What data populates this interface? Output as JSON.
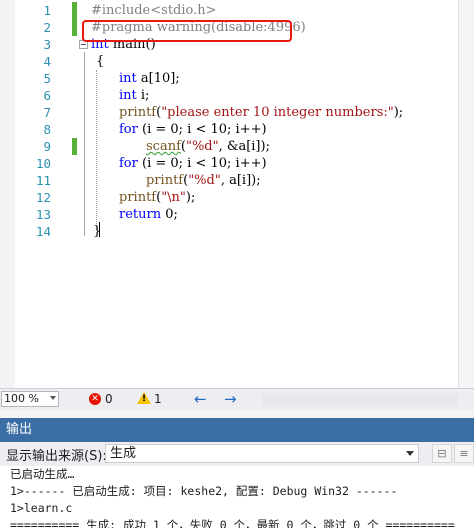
{
  "editor": {
    "line_numbers": [
      "1",
      "2",
      "3",
      "4",
      "5",
      "6",
      "7",
      "8",
      "9",
      "10",
      "11",
      "12",
      "13",
      "14"
    ],
    "code": {
      "l1": "#include<stdio.h>",
      "l2": "#pragma warning(disable:4996)",
      "l3_kw": "int",
      "l3_rest": " main()",
      "l4": "{",
      "l5_kw": "int",
      "l5_rest": " a[10];",
      "l6_kw": "int",
      "l6_rest": " i;",
      "l7_fn": "printf",
      "l7_a": "(",
      "l7_str": "\"please enter 10 integer numbers:\"",
      "l7_b": ");",
      "l8_kw": "for",
      "l8_rest": " (i = 0; i < 10; i++)",
      "l9_fn": "scanf",
      "l9_a": "(",
      "l9_str": "\"%d\"",
      "l9_b": ", &a[i]);",
      "l10_kw": "for",
      "l10_rest": " (i = 0; i < 10; i++)",
      "l11_fn": "printf",
      "l11_a": "(",
      "l11_str": "\"%d\"",
      "l11_b": ", a[i]);",
      "l12_fn": "printf",
      "l12_a": "(",
      "l12_str": "\"\\n\"",
      "l12_b": ");",
      "l13_kw": "return",
      "l13_rest": " 0;",
      "l14": "}"
    }
  },
  "status": {
    "zoom": "100 %",
    "errors": "0",
    "warnings": "1",
    "back_arrow": "←",
    "forward_arrow": "→"
  },
  "output": {
    "title": "输出",
    "source_label": "显示输出来源(S):",
    "source_value": "生成",
    "lines": [
      "已启动生成…",
      "1>------ 已启动生成: 项目: keshe2, 配置: Debug Win32 ------",
      "1>learn.c",
      "========== 生成: 成功 1 个，失败 0 个，最新 0 个，跳过 0 个 =========="
    ]
  },
  "colors": {
    "keyword": "#0000ff",
    "string": "#a31515",
    "line_number": "#2b91af",
    "highlight_box": "#e8180c",
    "change_bar": "#57b13b",
    "output_header": "#3a6ea5"
  }
}
